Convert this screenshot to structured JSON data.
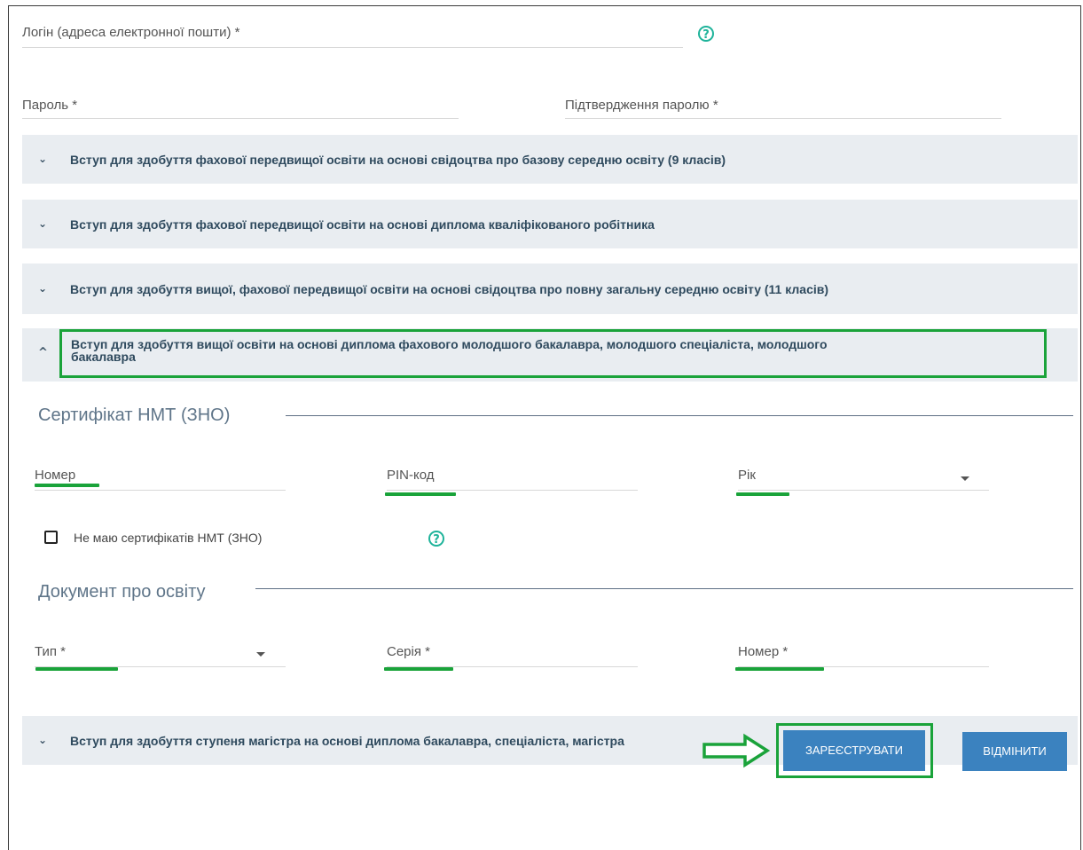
{
  "login": {
    "label": "Логін (адреса електронної пошти) *"
  },
  "password": {
    "label": "Пароль *"
  },
  "confirm_password": {
    "label": "Підтвердження паролю *"
  },
  "accordion": [
    {
      "title": "Вступ для здобуття фахової передвищої освіти на основі свідоцтва про базову середню освіту (9 класів)",
      "expanded": false
    },
    {
      "title": "Вступ для здобуття фахової передвищої освіти на основі диплома кваліфікованого робітника",
      "expanded": false
    },
    {
      "title": "Вступ для здобуття вищої, фахової передвищої освіти на основі свідоцтва про повну загальну середню освіту (11 класів)",
      "expanded": false
    },
    {
      "title_line1": "Вступ для здобуття вищої освіти на основі диплома фахового молодшого бакалавра, молодшого спеціаліста, молодшого",
      "title_line2": "бакалавра",
      "expanded": true
    },
    {
      "title": "Вступ для здобуття ступеня магістра на основі диплома бакалавра, спеціаліста, магістра",
      "expanded": false
    }
  ],
  "certificate": {
    "section_title": "Сертифікат НМТ (ЗНО)",
    "number_label": "Номер",
    "pin_label": "PIN-код",
    "year_label": "Рік",
    "no_cert_label": "Не маю сертифікатів НМТ (ЗНО)",
    "no_cert_checked": false
  },
  "education_doc": {
    "section_title": "Документ про освіту",
    "type_label": "Тип *",
    "series_label": "Серія *",
    "number_label": "Номер *"
  },
  "buttons": {
    "register": "ЗАРЕЄСТРУВАТИ",
    "cancel": "ВІДМІНИТИ"
  },
  "icons": {
    "help": "?",
    "chevron_down": "⌄",
    "chevron_up": "^"
  },
  "colors": {
    "highlight_green": "#1aa33a",
    "button_blue": "#3b82bf",
    "accordion_bg": "#e9edf1",
    "help_teal": "#1eb39a"
  }
}
